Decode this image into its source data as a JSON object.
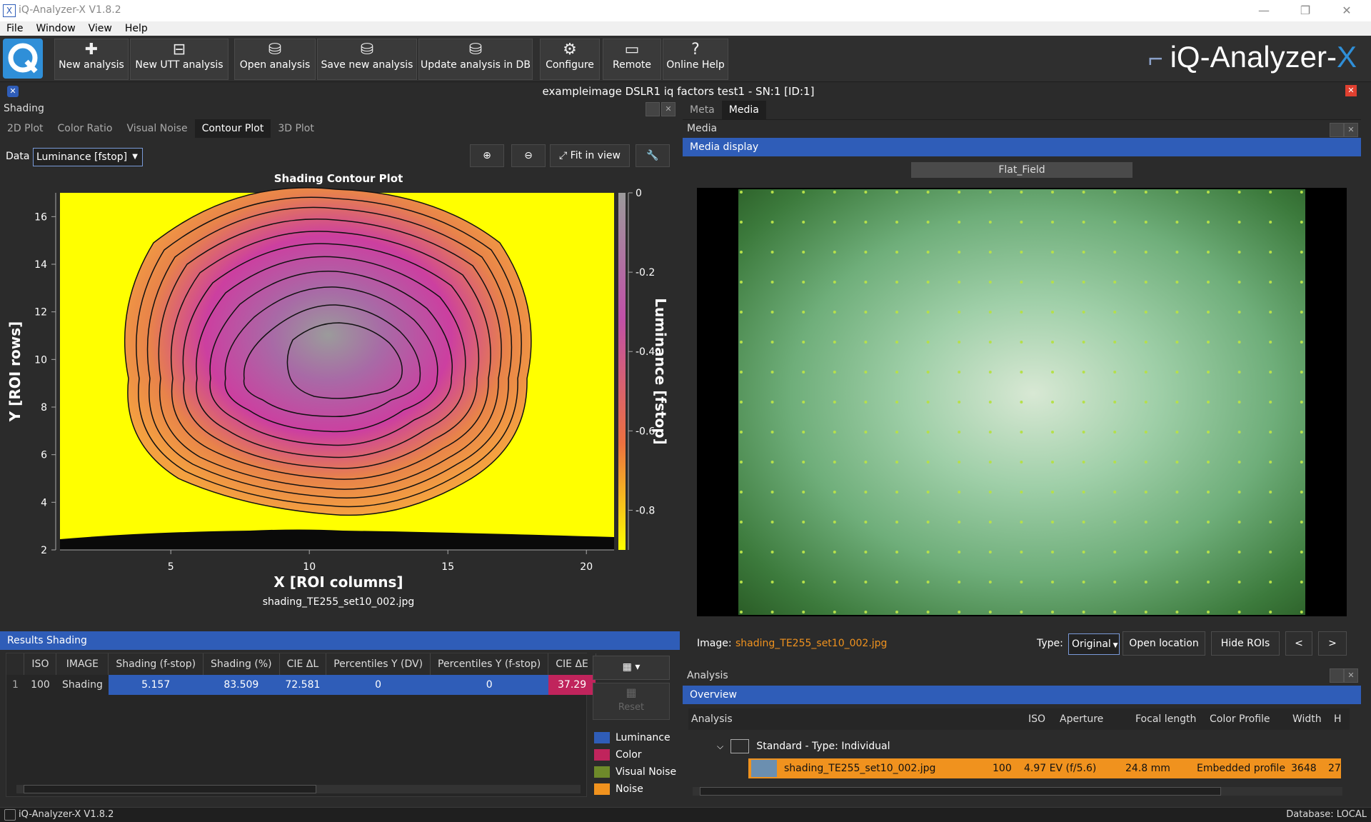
{
  "window": {
    "title": "iQ-Analyzer-X V1.8.2",
    "minimize": "—",
    "restore": "❐",
    "close": "✕"
  },
  "menu": [
    "File",
    "Window",
    "View",
    "Help"
  ],
  "toolbar": {
    "buttons": [
      {
        "label": "New analysis",
        "icon": "plus-icon"
      },
      {
        "label": "New UTT analysis",
        "icon": "utt-icon"
      },
      {
        "label": "Open analysis",
        "icon": "open-db-icon"
      },
      {
        "label": "Save new analysis",
        "icon": "save-db-icon"
      },
      {
        "label": "Update analysis in DB",
        "icon": "update-db-icon"
      },
      {
        "label": "Configure",
        "icon": "gear-icon"
      },
      {
        "label": "Remote",
        "icon": "monitor-icon"
      },
      {
        "label": "Online Help",
        "icon": "help-icon"
      }
    ],
    "brand": "iQ-Analyzer-",
    "brand_x": "X"
  },
  "document_title": "exampleimage DSLR1 iq factors test1 - SN:1 [ID:1]",
  "shading": {
    "panel_title": "Shading",
    "tabs": [
      "2D Plot",
      "Color Ratio",
      "Visual Noise",
      "Contour Plot",
      "3D Plot"
    ],
    "active_tab": "Contour Plot",
    "data_label": "Data",
    "data_value": "Luminance [fstop]",
    "fit_in_view": "Fit in view",
    "plot_title": "Shading Contour Plot",
    "filename": "shading_TE255_set10_002.jpg"
  },
  "chart_data": {
    "type": "heatmap",
    "title": "Shading Contour Plot",
    "xlabel": "X [ROI columns]",
    "ylabel": "Y [ROI rows]",
    "colorbar_label": "Luminance [fstop]",
    "xticks": [
      5,
      10,
      15,
      20
    ],
    "yticks": [
      2,
      4,
      6,
      8,
      10,
      12,
      14,
      16
    ],
    "colorbar_ticks": [
      0,
      -0.2,
      -0.4,
      -0.6,
      -0.8
    ],
    "xlim": [
      1,
      21
    ],
    "ylim": [
      2,
      17
    ],
    "colorbar_range": [
      -0.9,
      0
    ],
    "colormap": [
      "#ffff00",
      "#f4a140",
      "#cc3fa0",
      "#9b9b9b"
    ]
  },
  "results": {
    "panel_title": "Results Shading",
    "columns": [
      "ISO",
      "IMAGE",
      "Shading (f-stop)",
      "Shading (%)",
      "CIE ΔL",
      "Percentiles Y (DV)",
      "Percentiles Y (f-stop)",
      "CIE ΔE"
    ],
    "rows": [
      {
        "index": "1",
        "cells": [
          "100",
          "Shading",
          "5.157",
          "83.509",
          "72.581",
          "0",
          "0",
          "37.29"
        ]
      }
    ],
    "reset_label": "Reset",
    "legend": [
      {
        "label": "Luminance",
        "color": "#2f5db8"
      },
      {
        "label": "Color",
        "color": "#c0245c"
      },
      {
        "label": "Visual Noise",
        "color": "#6e8a2a"
      },
      {
        "label": "Noise",
        "color": "#f0921e"
      }
    ]
  },
  "media": {
    "tabs": [
      "Meta",
      "Media"
    ],
    "active_tab": "Media",
    "panel_title": "Media",
    "display_title": "Media display",
    "image_name_tab": "Flat_Field",
    "image_label": "Image:",
    "image_file": "shading_TE255_set10_002.jpg",
    "type_label": "Type:",
    "type_value": "Original",
    "open_location": "Open location",
    "hide_rois": "Hide ROIs",
    "prev": "<",
    "next": ">"
  },
  "analysis": {
    "panel_title": "Analysis",
    "overview": "Overview",
    "columns": [
      "Analysis",
      "ISO",
      "Aperture",
      "Focal length",
      "Color Profile",
      "Width",
      "H"
    ],
    "group": "Standard - Type: Individual",
    "row": {
      "name": "shading_TE255_set10_002.jpg",
      "iso": "100",
      "aperture": "4.97 EV (f/5.6)",
      "focal": "24.8 mm",
      "profile": "Embedded profile",
      "width": "3648",
      "h": "27"
    }
  },
  "status": {
    "left": "iQ-Analyzer-X V1.8.2",
    "right": "Database: LOCAL"
  }
}
